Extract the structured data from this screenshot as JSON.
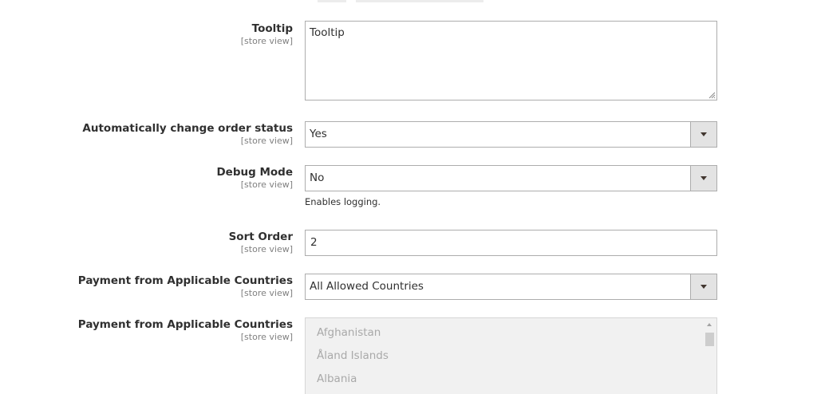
{
  "fields": {
    "tooltip": {
      "label": "Tooltip",
      "scope": "[store view]",
      "value": "Tooltip"
    },
    "auto_change_status": {
      "label": "Automatically change order status",
      "scope": "[store view]",
      "value": "Yes"
    },
    "debug_mode": {
      "label": "Debug Mode",
      "scope": "[store view]",
      "value": "No",
      "note": "Enables logging."
    },
    "sort_order": {
      "label": "Sort Order",
      "scope": "[store view]",
      "value": "2"
    },
    "applicable_countries": {
      "label": "Payment from Applicable Countries",
      "scope": "[store view]",
      "value": "All Allowed Countries"
    },
    "specific_countries": {
      "label": "Payment from Applicable Countries",
      "scope": "[store view]",
      "options": [
        "Afghanistan",
        "Åland Islands",
        "Albania"
      ]
    }
  },
  "icons": {
    "dropdown": "chevron-down-icon",
    "scroll_up": "arrow-up-icon",
    "resize": "resize-grip-icon"
  },
  "colors": {
    "border": "#adadad",
    "select_button": "#e3e3e3",
    "disabled_bg": "#f1f1f1",
    "disabled_text": "#a9a9a9",
    "label_text": "#303030",
    "scope_text": "#808080"
  }
}
